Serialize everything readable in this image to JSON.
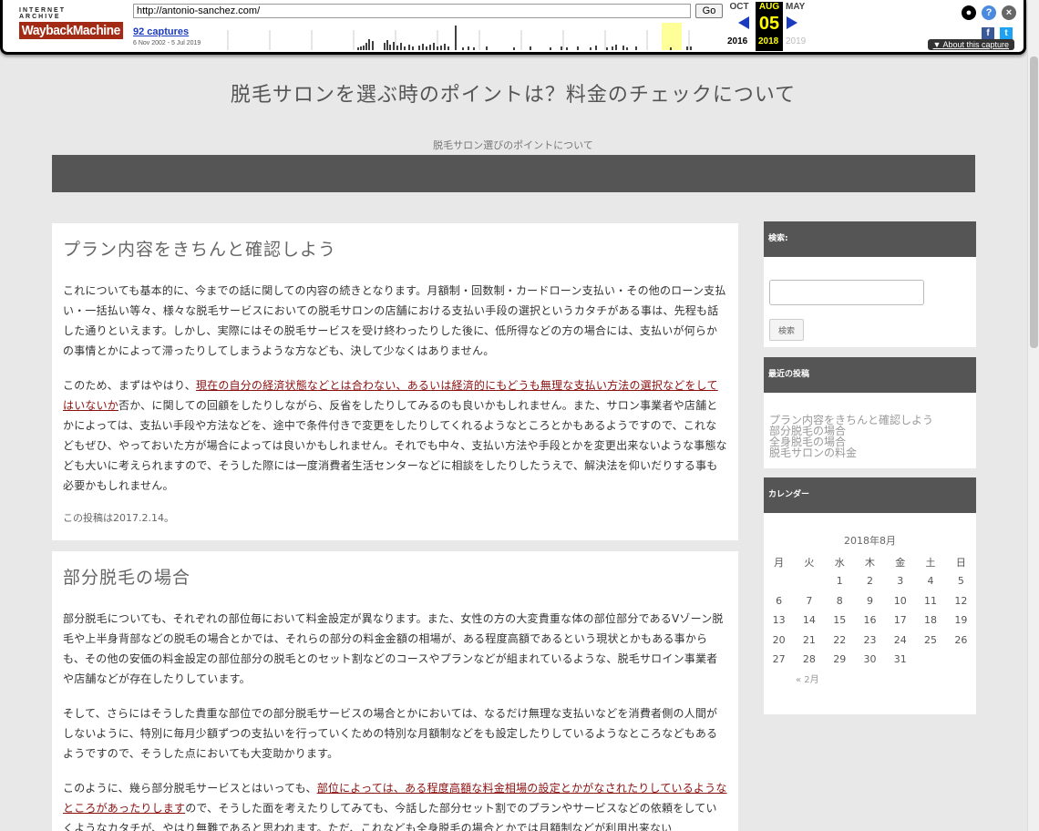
{
  "wayback": {
    "logo_top": "INTERNET ARCHIVE",
    "logo_main": "WaybackMachine",
    "url": "http://antonio-sanchez.com/",
    "go_label": "Go",
    "captures": "92 captures",
    "range": "6 Nov 2002 - 5 Jul 2019",
    "prev_month": "OCT",
    "cur_month": "AUG",
    "next_month": "MAY",
    "cur_day": "05",
    "prev_year": "2016",
    "cur_year": "2018",
    "next_year": "2019",
    "about": "About this capture",
    "facebook": "f",
    "twitter": "t"
  },
  "site": {
    "title": "脱毛サロンを選ぶ時のポイントは？料金のチェックについて",
    "description": "脱毛サロン選びのポイントについて"
  },
  "posts": [
    {
      "title": "プラン内容をきちんと確認しよう",
      "p1": "これについても基本的に、今までの話に関しての内容の続きとなります。月額制・回数制・カードローン支払い・その他のローン支払い・一括払い等々、様々な脱毛サービスにおいての脱毛サロンの店舗における支払い手段の選択というカタチがある事は、先程も話した通りといえます。しかし、実際にはその脱毛サービスを受け終わったりした後に、低所得などの方の場合には、支払いが何らかの事情とかによって滞ったりしてしまうような方なども、決して少なくはありません。",
      "p2_before": "このため、まずはやはり、",
      "p2_link": "現在の自分の経済状態などとは合わない、あるいは経済的にもどうも無理な支払い方法の選択などをしてはいないか",
      "p2_after": "否か、に関しての回顧をしたりしながら、反省をしたりしてみるのも良いかもしれません。また、サロン事業者や店舗とかによっては、支払い手段や方法などを、途中で条件付きで変更をしたりしてくれるようなところとかもあるようですので、これなどもぜひ、やっておいた方が場合によっては良いかもしれません。それでも中々、支払い方法や手段とかを変更出来ないような事態なども大いに考えられますので、そうした際には一度消費者生活センターなどに相談をしたりしたうえで、解決法を仰いだりする事も必要かもしれません。",
      "meta": "この投稿は2017.2.14。"
    },
    {
      "title": "部分脱毛の場合",
      "p1": "部分脱毛についても、それぞれの部位毎において料金設定が異なります。また、女性の方の大変貴重な体の部位部分であるVゾーン脱毛や上半身背部などの脱毛の場合とかでは、それらの部分の料金金額の相場が、ある程度高額であるという現状とかもある事からも、その他の安価の料金設定の部位部分の脱毛とのセット割などのコースやプランなどが組まれているような、脱毛サロイン事業者や店舗などが存在したりしています。",
      "p2": "そして、さらにはそうした貴重な部位での部分脱毛サービスの場合とかにおいては、なるだけ無理な支払いなどを消費者側の人間がしないように、特別に毎月少額ずつの支払いを行っていくための特別な月額制などをも設定したりしているようなところなどもあるようですので、そうした点においても大変助かります。",
      "p3_before": "このように、幾ら部分脱毛サービスとはいっても、",
      "p3_link": "部位によっては、ある程度高額な料金相場の設定とかがなされたりしているようなところがあったりします",
      "p3_after": "ので、そうした面を考えたりしてみても、今話した部分セット割でのプランやサービスなどの依頼をしていくようなカタチが、やはり無難であると思われます。ただ、これなども全身脱毛の場合とかでは月額制などが利用出来ない"
    }
  ],
  "sidebar": {
    "search_title": "検索:",
    "search_button": "検索",
    "recent_title": "最近の投稿",
    "recent": [
      "プラン内容をきちんと確認しよう",
      "部分脱毛の場合",
      "全身脱毛の場合",
      "脱毛サロンの料金"
    ],
    "calendar_title": "カレンダー",
    "calendar_caption": "2018年8月",
    "weekdays": [
      "月",
      "火",
      "水",
      "木",
      "金",
      "土",
      "日"
    ],
    "weeks": [
      [
        "",
        "",
        "1",
        "2",
        "3",
        "4",
        "5"
      ],
      [
        "6",
        "7",
        "8",
        "9",
        "10",
        "11",
        "12"
      ],
      [
        "13",
        "14",
        "15",
        "16",
        "17",
        "18",
        "19"
      ],
      [
        "20",
        "21",
        "22",
        "23",
        "24",
        "25",
        "26"
      ],
      [
        "27",
        "28",
        "29",
        "30",
        "31",
        "",
        ""
      ]
    ],
    "prev_link": "« 2月"
  },
  "colors": {
    "background": "#e8e8e8",
    "bar": "#555555",
    "link": "#8b1010",
    "wayback_highlight": "#ffff00"
  }
}
